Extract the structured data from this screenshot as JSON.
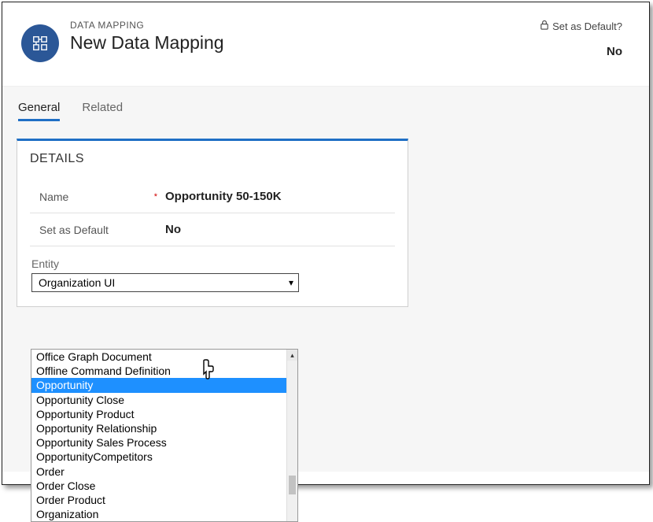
{
  "header": {
    "eyebrow": "DATA MAPPING",
    "title": "New Data Mapping",
    "setDefaultLabel": "Set as Default?",
    "setDefaultValue": "No"
  },
  "tabs": {
    "general": "General",
    "related": "Related"
  },
  "details": {
    "cardTitle": "DETAILS",
    "nameLabel": "Name",
    "nameValue": "Opportunity 50-150K",
    "defaultLabel": "Set as Default",
    "defaultValue": "No",
    "entityLabel": "Entity",
    "entitySelected": "Organization UI"
  },
  "dropdown": {
    "items": [
      "Office Graph Document",
      "Offline Command Definition",
      "Opportunity",
      "Opportunity Close",
      "Opportunity Product",
      "Opportunity Relationship",
      "Opportunity Sales Process",
      "OpportunityCompetitors",
      "Order",
      "Order Close",
      "Order Product",
      "Organization"
    ],
    "highlightIndex": 2
  }
}
